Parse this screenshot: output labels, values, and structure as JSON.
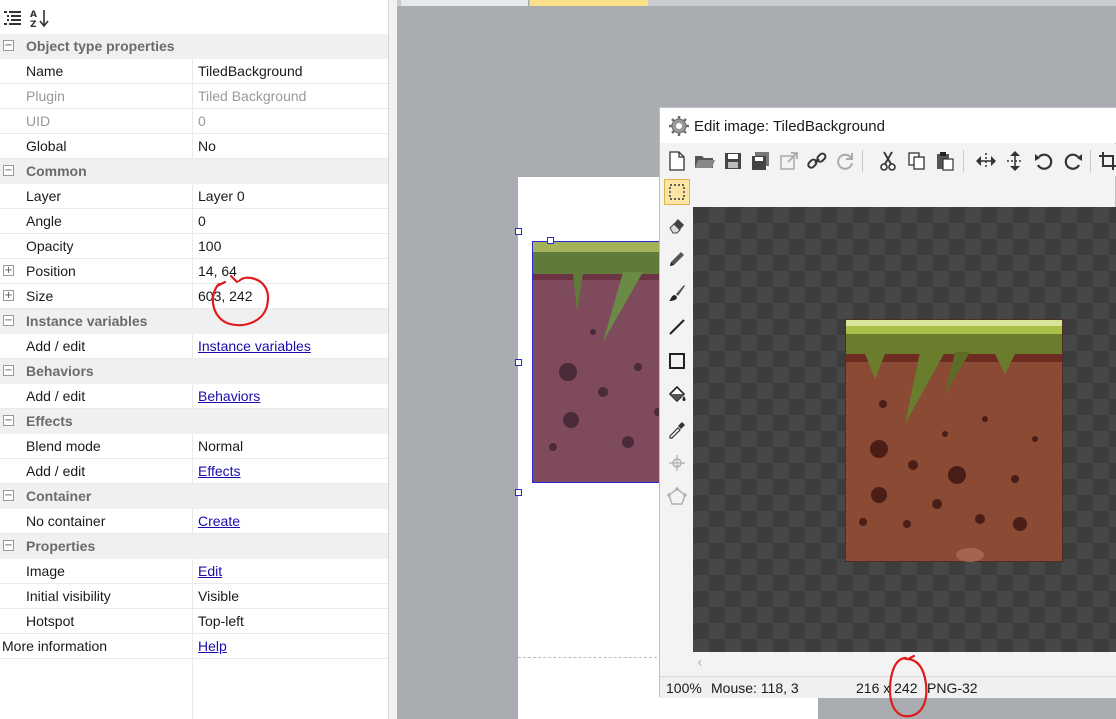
{
  "properties": {
    "rows": [
      {
        "kind": "cat",
        "label": "Object type properties"
      },
      {
        "kind": "prop",
        "name": "Name",
        "value": "TiledBackground"
      },
      {
        "kind": "prop",
        "name": "Plugin",
        "value": "Tiled Background",
        "dim": true
      },
      {
        "kind": "prop",
        "name": "UID",
        "value": "0",
        "dim": true
      },
      {
        "kind": "prop",
        "name": "Global",
        "value": "No"
      },
      {
        "kind": "cat",
        "label": "Common"
      },
      {
        "kind": "prop",
        "name": "Layer",
        "value": "Layer 0"
      },
      {
        "kind": "prop",
        "name": "Angle",
        "value": "0"
      },
      {
        "kind": "prop",
        "name": "Opacity",
        "value": "100"
      },
      {
        "kind": "prop",
        "name": "Position",
        "value": "14, 64",
        "expandable": true
      },
      {
        "kind": "prop",
        "name": "Size",
        "value": "603, 242",
        "expandable": true
      },
      {
        "kind": "cat",
        "label": "Instance variables"
      },
      {
        "kind": "prop",
        "name": "Add / edit",
        "value": "Instance variables",
        "link": true
      },
      {
        "kind": "cat",
        "label": "Behaviors"
      },
      {
        "kind": "prop",
        "name": "Add / edit",
        "value": "Behaviors",
        "link": true
      },
      {
        "kind": "cat",
        "label": "Effects"
      },
      {
        "kind": "prop",
        "name": "Blend mode",
        "value": "Normal"
      },
      {
        "kind": "prop",
        "name": "Add / edit",
        "value": "Effects",
        "link": true
      },
      {
        "kind": "cat",
        "label": "Container"
      },
      {
        "kind": "prop",
        "name": "No container",
        "value": "Create",
        "link": true
      },
      {
        "kind": "cat",
        "label": "Properties"
      },
      {
        "kind": "prop",
        "name": "Image",
        "value": "Edit",
        "link": true
      },
      {
        "kind": "prop",
        "name": "Initial visibility",
        "value": "Visible"
      },
      {
        "kind": "prop",
        "name": "Hotspot",
        "value": "Top-left"
      },
      {
        "kind": "prop",
        "name": "More information",
        "value": "Help",
        "link": true,
        "wide": true
      }
    ]
  },
  "editor": {
    "title": "Edit image: TiledBackground",
    "status": {
      "zoom": "100%",
      "mouse": "Mouse: 118, 3",
      "size": "216 x 242",
      "format": "PNG-32"
    }
  },
  "colors": {
    "annotation": "#e01a1a",
    "link": "#1a0dab",
    "selection": "#2b2bd6",
    "dirt": "#8a4a33",
    "grass": "#6a7d2c"
  }
}
